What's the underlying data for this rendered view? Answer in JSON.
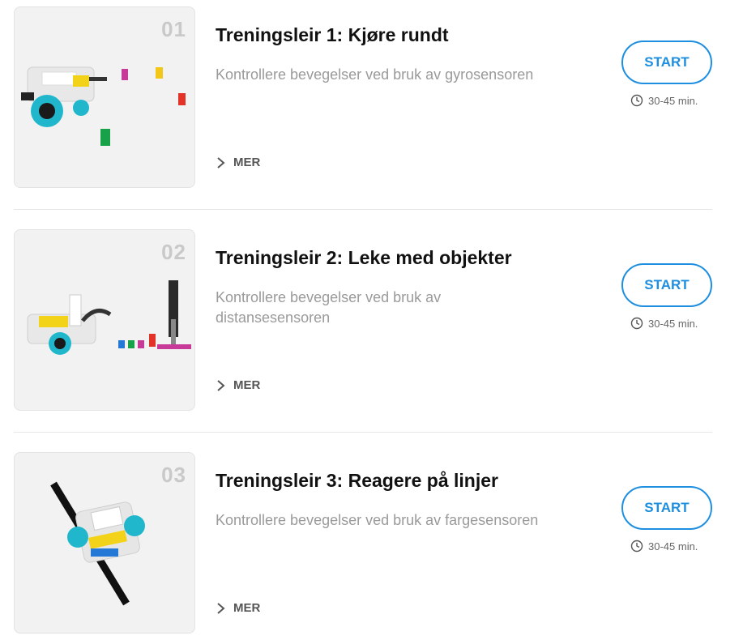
{
  "colors": {
    "accent": "#1e8fe0",
    "number": "#c9c9c9",
    "description": "#9a9a9a"
  },
  "lessons": [
    {
      "number": "01",
      "title": "Treningsleir 1: Kjøre rundt",
      "description": "Kontrollere bevegelser ved bruk av gyrosensoren",
      "more_label": "MER",
      "start_label": "START",
      "duration": "30-45 min.",
      "image": "robot-with-colored-bricks"
    },
    {
      "number": "02",
      "title": "Treningsleir 2: Leke med objekter",
      "description": "Kontrollere bevegelser ved bruk av distansesensoren",
      "more_label": "MER",
      "start_label": "START",
      "duration": "30-45 min.",
      "image": "robot-with-arm-and-objects"
    },
    {
      "number": "03",
      "title": "Treningsleir 3: Reagere på linjer",
      "description": "Kontrollere bevegelser ved bruk av fargesensoren",
      "more_label": "MER",
      "start_label": "START",
      "duration": "30-45 min.",
      "image": "robot-on-black-line"
    }
  ]
}
